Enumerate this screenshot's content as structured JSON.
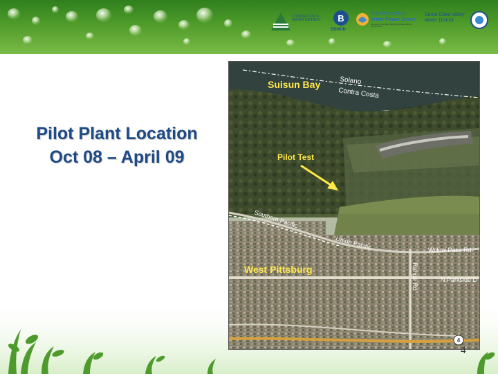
{
  "slide": {
    "title_line1": "Pilot Plant Location",
    "title_line2": "Oct 08 – April 09",
    "page_number": "4"
  },
  "logos": {
    "contra_costa": "CONTRA COSTA WATER DISTRICT",
    "ebmud": "EBMUD",
    "sf_line1": "San Francisco",
    "sf_line2": "Water Power Sewer",
    "sf_line3": "Services of the San Francisco Public Utilities Commission",
    "scv_line1": "Santa Clara Valley",
    "scv_line2": "Water District"
  },
  "map": {
    "labels": {
      "suisun_bay": "Suisun Bay",
      "solano": "Solano",
      "contra_costa": "Contra Costa",
      "pilot_test": "Pilot Test",
      "southern_pacific": "Southern Pacific",
      "union_pacific": "Union Pacific",
      "willow_pass": "Willow Pass Rd",
      "west_pittsburg": "West Pittsburg",
      "range_rd": "Range Rd",
      "parkside": "N Parkside D",
      "route": "4"
    }
  },
  "colors": {
    "title": "#1e4a86",
    "banner_green": "#4f9b2a",
    "map_label": "#ffe84a",
    "arrow": "#ffe84a"
  }
}
